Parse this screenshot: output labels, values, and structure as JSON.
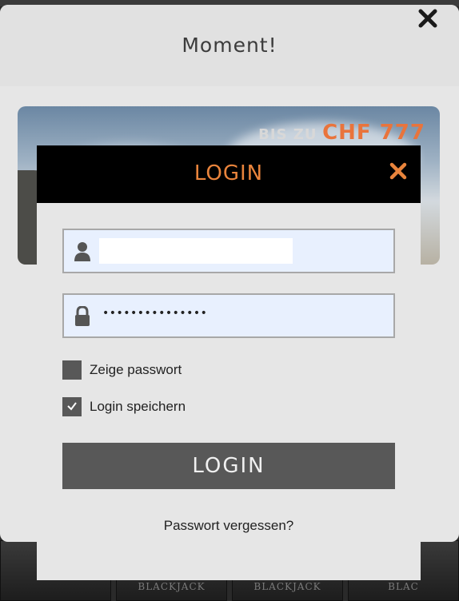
{
  "background": {
    "thumbnails": [
      {
        "label": ""
      },
      {
        "label": "BLACKJACK"
      },
      {
        "label": "BLACKJACK"
      },
      {
        "label": "BLAC"
      }
    ]
  },
  "moment_dialog": {
    "title": "Moment!",
    "close_icon": "close-icon",
    "banner": {
      "pre_text": "BIS ZU",
      "amount": "CHF 777"
    }
  },
  "login_dialog": {
    "title": "LOGIN",
    "close_icon": "close-icon",
    "username": {
      "value": "",
      "icon": "user-icon"
    },
    "password": {
      "masked_value": "•••••••••••••••",
      "icon": "lock-icon"
    },
    "show_password": {
      "label": "Zeige passwort",
      "checked": false
    },
    "remember_login": {
      "label": "Login speichern",
      "checked": true
    },
    "submit_label": "LOGIN",
    "forgot_link": "Passwort vergessen?"
  },
  "colors": {
    "accent": "#e9843c",
    "button_bg": "#585858",
    "header_bg": "#000000",
    "field_bg": "#e8f0fe"
  }
}
